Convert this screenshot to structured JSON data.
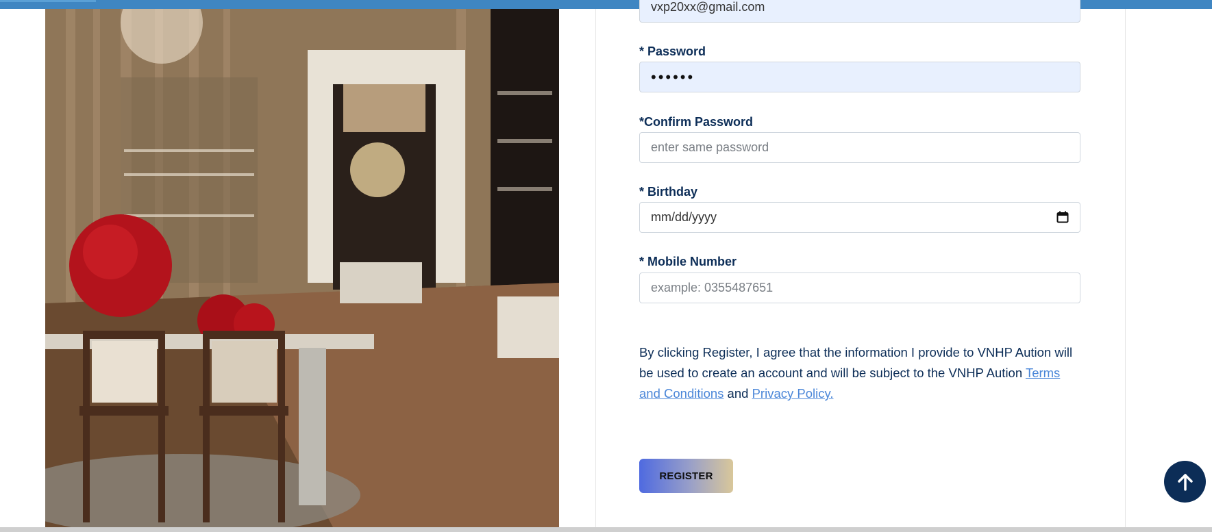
{
  "form": {
    "email": {
      "value": "vxp20xx@gmail.com"
    },
    "password": {
      "label": "* Password",
      "value": "••••••"
    },
    "confirm_password": {
      "label": "*Confirm Password",
      "placeholder": "enter same password"
    },
    "birthday": {
      "label": "* Birthday",
      "placeholder": "mm/dd/yyyy"
    },
    "mobile": {
      "label": "* Mobile Number",
      "placeholder": "example: 0355487651"
    }
  },
  "agreement": {
    "text": "By clicking Register, I agree that the information I provide to VNHP Aution will be used to create an account and will be subject to the VNHP Aution ",
    "terms_link": "Terms and Conditions",
    "and": " and ",
    "privacy_link": "Privacy Policy."
  },
  "buttons": {
    "register": "REGISTER"
  },
  "icons": {
    "calendar": "calendar-icon",
    "scroll_top": "arrow-up-icon"
  },
  "colors": {
    "topbar": "#3f86c2",
    "label": "#0c2d57",
    "link": "#4a86d8",
    "autofill": "#e8f0fe",
    "scroll_top_bg": "#0c2d57"
  }
}
